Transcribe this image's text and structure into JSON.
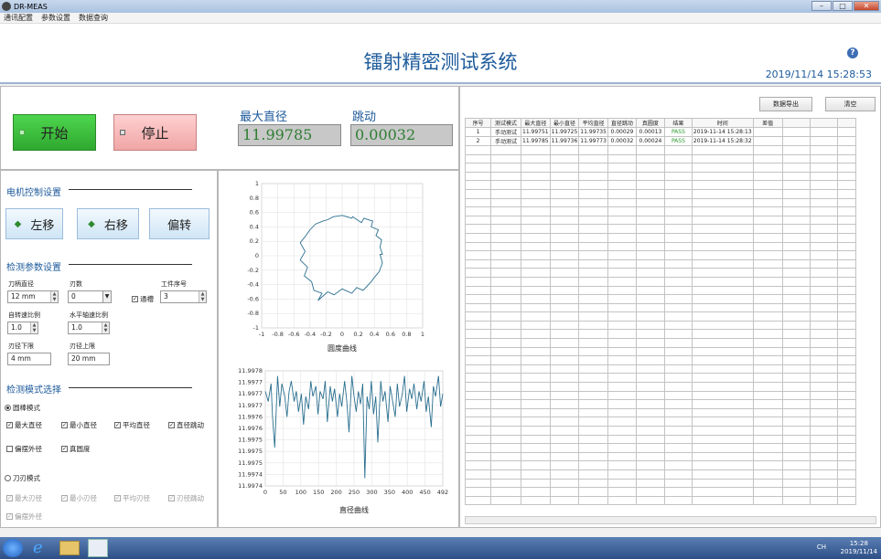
{
  "window": {
    "title": "DR-MEAS",
    "min": "–",
    "max": "□",
    "close": "✕"
  },
  "menu": [
    "通讯配置",
    "参数设置",
    "数据查询"
  ],
  "header": {
    "title": "镭射精密测试系统",
    "datetime": "2019/11/14 15:28:53",
    "help": "?"
  },
  "controls": {
    "start": "开始",
    "stop": "停止",
    "max_diameter_label": "最大直径",
    "max_diameter_value": "11.99785",
    "runout_label": "跳动",
    "runout_value": "0.00032"
  },
  "motor": {
    "title": "电机控制设置",
    "left": "左移",
    "right": "右移",
    "deflect": "偏转"
  },
  "params": {
    "title": "检测参数设置",
    "shank_label": "刀柄直径",
    "shank_value": "12 mm",
    "blades_label": "刃数",
    "blades_value": "0",
    "through_label": "通槽",
    "through_checked": true,
    "work_label": "工件序号",
    "work_value": "3",
    "self_ratio_label": "自转速比例",
    "self_ratio_value": "1.0",
    "h_ratio_label": "水平轴速比例",
    "h_ratio_value": "1.0",
    "lower_label": "刃径下限",
    "lower_value": "4 mm",
    "upper_label": "刃径上限",
    "upper_value": "20 mm"
  },
  "modes": {
    "title": "检测模式选择",
    "rod_mode": "圆棒模式",
    "rod_selected": true,
    "rod_checks": [
      {
        "label": "最大直径",
        "checked": true
      },
      {
        "label": "最小直径",
        "checked": true
      },
      {
        "label": "平均直径",
        "checked": true
      },
      {
        "label": "直径跳动",
        "checked": true
      },
      {
        "label": "偏摆外径",
        "checked": false
      },
      {
        "label": "真圆度",
        "checked": true
      }
    ],
    "blade_mode": "刀刃模式",
    "blade_selected": false,
    "blade_checks": [
      {
        "label": "最大刃径",
        "checked": true
      },
      {
        "label": "最小刃径",
        "checked": true
      },
      {
        "label": "平均刃径",
        "checked": true
      },
      {
        "label": "刃径跳动",
        "checked": true
      },
      {
        "label": "偏摆外径",
        "checked": true
      }
    ]
  },
  "chart_data": [
    {
      "type": "line",
      "title": "",
      "xlabel": "圆度曲线",
      "ylabel": "",
      "xlim": [
        -1,
        1
      ],
      "ylim": [
        -1,
        1
      ],
      "xticks": [
        "-1",
        "-0.8",
        "-0.6",
        "-0.4",
        "-0.2",
        "0",
        "0.2",
        "0.4",
        "0.6",
        "0.8",
        "1"
      ],
      "yticks": [
        "1",
        "0.8",
        "0.6",
        "0.4",
        "0.2",
        "0",
        "-0.2",
        "-0.4",
        "-0.6",
        "-0.8",
        "-1"
      ],
      "grid": true,
      "series": [
        {
          "closed": true,
          "color": "#2a6f8f",
          "x": [
            0.5,
            0.47,
            0.49,
            0.42,
            0.45,
            0.36,
            0.38,
            0.27,
            0.24,
            0.13,
            0.12,
            0.0,
            -0.11,
            -0.18,
            -0.24,
            -0.33,
            -0.4,
            -0.45,
            -0.52,
            -0.46,
            -0.52,
            -0.43,
            -0.47,
            -0.38,
            -0.35,
            -0.25,
            -0.3,
            -0.18,
            -0.1,
            0.0,
            0.12,
            0.18,
            0.26,
            0.36,
            0.4,
            0.46,
            0.5,
            0.47
          ],
          "y": [
            0.02,
            0.12,
            0.22,
            0.28,
            0.36,
            0.4,
            0.48,
            0.52,
            0.46,
            0.54,
            0.52,
            0.56,
            0.54,
            0.5,
            0.48,
            0.44,
            0.36,
            0.28,
            0.18,
            0.06,
            -0.06,
            -0.16,
            -0.28,
            -0.36,
            -0.48,
            -0.52,
            -0.62,
            -0.5,
            -0.54,
            -0.46,
            -0.52,
            -0.44,
            -0.48,
            -0.36,
            -0.3,
            -0.22,
            -0.1,
            0.02
          ]
        }
      ]
    },
    {
      "type": "line",
      "title": "",
      "xlabel": "直径曲线",
      "ylabel": "",
      "xlim": [
        0,
        492
      ],
      "ylim": [
        11.99735,
        11.9978
      ],
      "xticks": [
        "0",
        "50",
        "100",
        "150",
        "200",
        "250",
        "300",
        "350",
        "400",
        "450",
        "492"
      ],
      "yticks": [
        "11.9978",
        "11.9977",
        "11.9977",
        "11.9977",
        "11.9976",
        "11.9976",
        "11.9975",
        "11.9975",
        "11.9975",
        "11.9974",
        "11.9974"
      ],
      "grid": true,
      "series": [
        {
          "color": "#2a6f8f",
          "x": [
            0,
            8,
            16,
            20,
            26,
            34,
            40,
            46,
            54,
            60,
            66,
            72,
            80,
            86,
            92,
            100,
            106,
            112,
            120,
            126,
            132,
            140,
            146,
            152,
            160,
            166,
            172,
            180,
            186,
            192,
            200,
            206,
            212,
            220,
            226,
            232,
            240,
            246,
            252,
            258,
            264,
            270,
            276,
            282,
            288,
            294,
            300,
            306,
            312,
            320,
            326,
            332,
            340,
            346,
            352,
            360,
            366,
            372,
            380,
            386,
            392,
            400,
            406,
            412,
            420,
            426,
            432,
            440,
            446,
            452,
            460,
            466,
            472,
            480,
            486,
            492
          ],
          "y": [
            11.99772,
            11.99768,
            11.99775,
            11.99762,
            11.9975,
            11.99778,
            11.99766,
            11.99775,
            11.9977,
            11.99762,
            11.99772,
            11.99776,
            11.99768,
            11.99772,
            11.99764,
            11.99771,
            11.99759,
            11.9977,
            11.99765,
            11.99776,
            11.9977,
            11.99774,
            11.99763,
            11.99772,
            11.99769,
            11.99776,
            11.9976,
            11.99774,
            11.99768,
            11.99773,
            11.99762,
            11.99771,
            11.99766,
            11.99776,
            11.99768,
            11.99756,
            11.99778,
            11.9977,
            11.99764,
            11.99772,
            11.99767,
            11.99775,
            11.99738,
            11.9977,
            11.99765,
            11.99776,
            11.99763,
            11.9977,
            11.99752,
            11.99776,
            11.99768,
            11.99772,
            11.9976,
            11.99774,
            11.99769,
            11.99762,
            11.99775,
            11.99766,
            11.99771,
            11.99778,
            11.99764,
            11.99773,
            11.99769,
            11.99775,
            11.99765,
            11.99772,
            11.99768,
            11.99776,
            11.99764,
            11.9977,
            11.99758,
            11.99774,
            11.9977,
            11.99778,
            11.99766,
            11.99771
          ]
        }
      ]
    }
  ],
  "table": {
    "export": "数据导出",
    "clear": "清空",
    "headers": [
      "序号",
      "测试模式",
      "最大直径",
      "最小直径",
      "平均直径",
      "直径跳动",
      "真圆度",
      "结果",
      "时间",
      "差值",
      "",
      "",
      ""
    ],
    "rows": [
      [
        "1",
        "手动测试",
        "11.99751",
        "11.99725",
        "11.99735",
        "0.00029",
        "0.00013",
        "PASS",
        "2019-11-14 15:28:13",
        "",
        "",
        "",
        ""
      ],
      [
        "2",
        "手动测试",
        "11.99785",
        "11.99736",
        "11.99773",
        "0.00032",
        "0.00024",
        "PASS",
        "2019-11-14 15:28:32",
        "",
        "",
        "",
        ""
      ]
    ],
    "empty_rows": 41
  },
  "taskbar": {
    "time": "15:28",
    "date": "2019/11/14",
    "tray": "CH"
  }
}
